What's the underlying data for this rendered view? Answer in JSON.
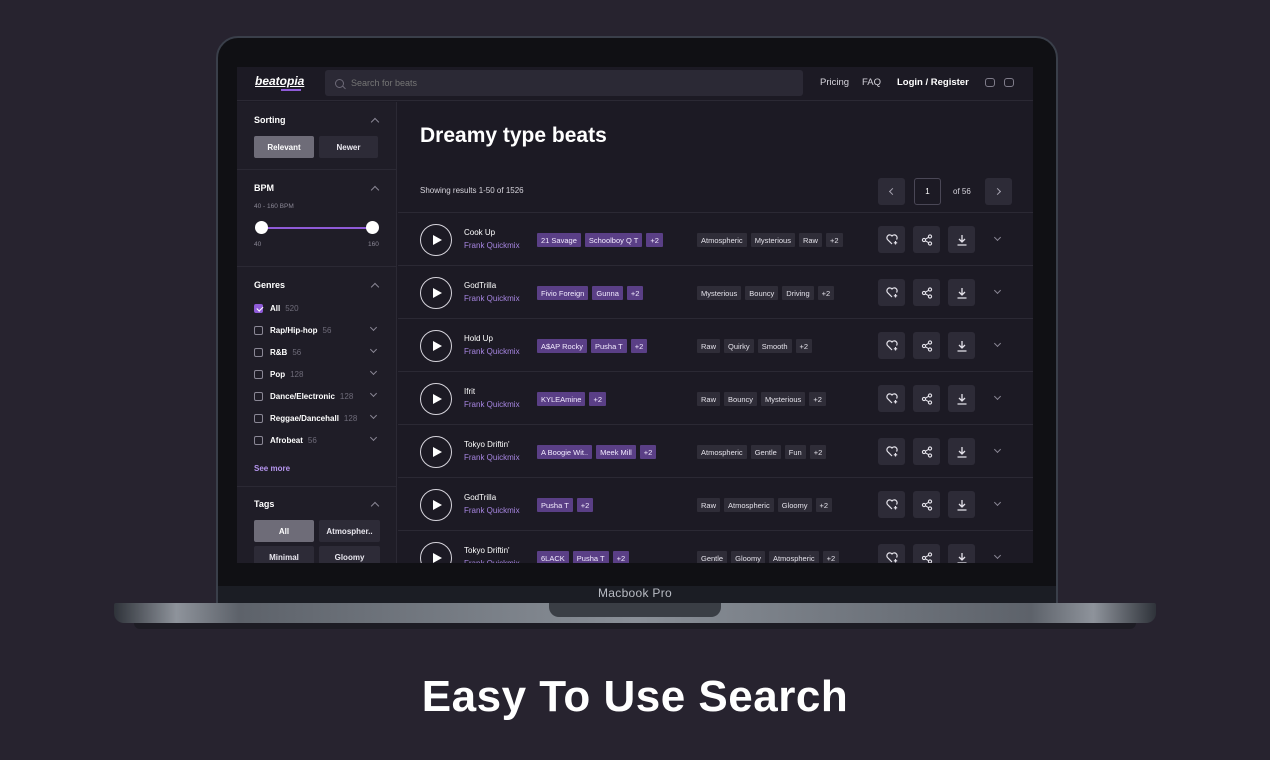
{
  "device_label": "Macbook Pro",
  "tagline": "Easy To Use Search",
  "header": {
    "logo": "beatopia",
    "search_placeholder": "Search for beats",
    "nav": {
      "pricing": "Pricing",
      "faq": "FAQ",
      "login": "Login / Register"
    },
    "social_icons": [
      "youtube-icon",
      "instagram-icon"
    ]
  },
  "sidebar": {
    "sorting": {
      "title": "Sorting",
      "options": [
        "Relevant",
        "Newer"
      ],
      "selected": "Relevant"
    },
    "bpm": {
      "title": "BPM",
      "range_label": "40 - 160 BPM",
      "min_label": "40",
      "max_label": "160",
      "min": 40,
      "max": 160,
      "low": 40,
      "high": 160
    },
    "genres": {
      "title": "Genres",
      "items": [
        {
          "name": "All",
          "count": "520",
          "checked": true
        },
        {
          "name": "Rap/Hip-hop",
          "count": "56"
        },
        {
          "name": "R&B",
          "count": "56"
        },
        {
          "name": "Pop",
          "count": "128"
        },
        {
          "name": "Dance/Electronic",
          "count": "128"
        },
        {
          "name": "Reggae/Dancehall",
          "count": "128"
        },
        {
          "name": "Afrobeat",
          "count": "56"
        }
      ],
      "see_more": "See more"
    },
    "tags": {
      "title": "Tags",
      "items": [
        "All",
        "Atmospher..",
        "Minimal",
        "Gloomy"
      ],
      "selected": "All"
    }
  },
  "main": {
    "title": "Dreamy type beats",
    "results_text": "Showing results 1-50 of 1526",
    "pagination": {
      "current": "1",
      "of_text": "of 56"
    },
    "tracks": [
      {
        "name": "Cook Up",
        "artist": "Frank Quickmix",
        "artists": [
          "21 Savage",
          "Schoolboy Q T",
          "+2"
        ],
        "moods": [
          "Atmospheric",
          "Mysterious",
          "Raw",
          "+2"
        ]
      },
      {
        "name": "GodTrilla",
        "artist": "Frank Quickmix",
        "artists": [
          "Fivio Foreign",
          "Gunna",
          "+2"
        ],
        "moods": [
          "Mysterious",
          "Bouncy",
          "Driving",
          "+2"
        ]
      },
      {
        "name": "Hold Up",
        "artist": "Frank Quickmix",
        "artists": [
          "A$AP Rocky",
          "Pusha T",
          "+2"
        ],
        "moods": [
          "Raw",
          "Quirky",
          "Smooth",
          "+2"
        ]
      },
      {
        "name": "Ifrit",
        "artist": "Frank Quickmix",
        "artists": [
          "KYLEAmine",
          "+2"
        ],
        "moods": [
          "Raw",
          "Bouncy",
          "Mysterious",
          "+2"
        ]
      },
      {
        "name": "Tokyo Driftin'",
        "artist": "Frank Quickmix",
        "artists": [
          "A Boogie Wit..",
          "Meek Mill",
          "+2"
        ],
        "moods": [
          "Atmospheric",
          "Gentle",
          "Fun",
          "+2"
        ]
      },
      {
        "name": "GodTrilla",
        "artist": "Frank Quickmix",
        "artists": [
          "Pusha T",
          "+2"
        ],
        "moods": [
          "Raw",
          "Atmospheric",
          "Gloomy",
          "+2"
        ]
      },
      {
        "name": "Tokyo Driftin'",
        "artist": "Frank Quickmix",
        "artists": [
          "6LACK",
          "Pusha T",
          "+2"
        ],
        "moods": [
          "Gentle",
          "Gloomy",
          "Atmospheric",
          "+2"
        ]
      }
    ]
  },
  "colors": {
    "accent": "#8f5bd8",
    "artist_chip": "#5a3f86",
    "background": "#27232f"
  }
}
